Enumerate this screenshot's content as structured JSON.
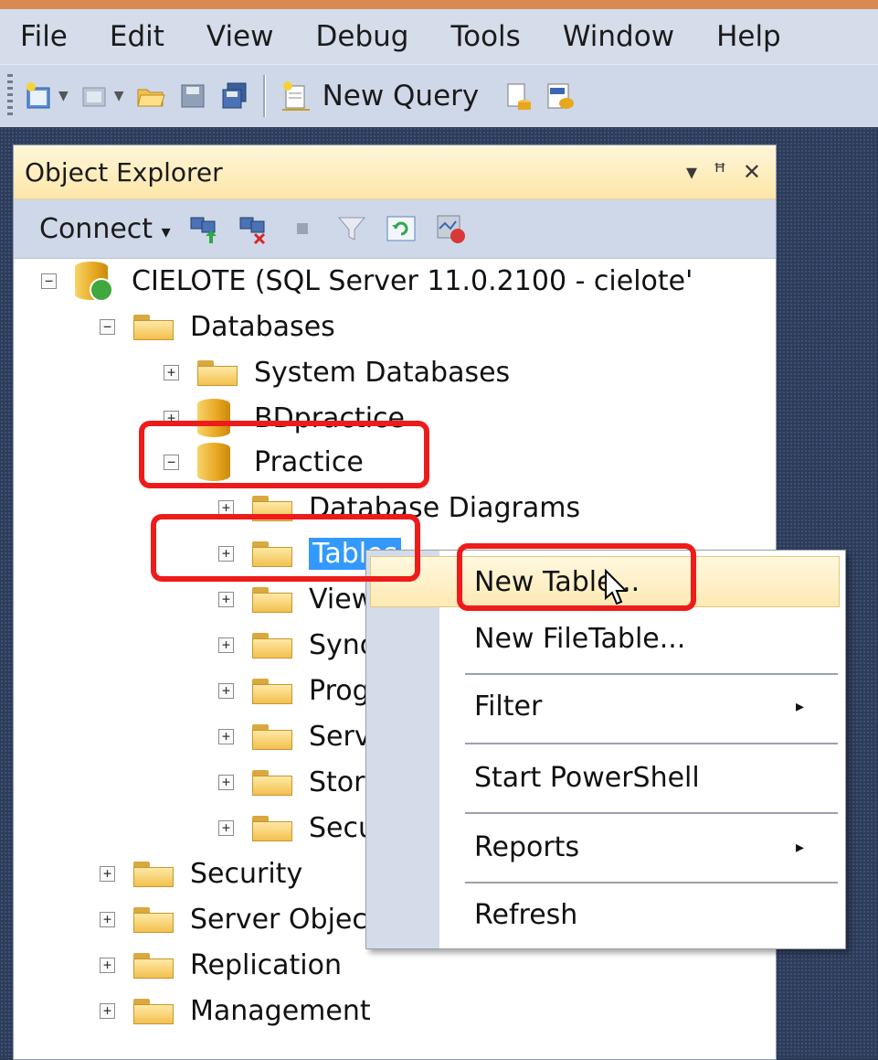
{
  "menu": [
    "File",
    "Edit",
    "View",
    "Debug",
    "Tools",
    "Window",
    "Help"
  ],
  "toolbar": {
    "new_query_label": "New Query"
  },
  "object_explorer": {
    "title": "Object Explorer",
    "title_icons": {
      "dropdown": "▾",
      "pin": "ꟸ",
      "close": "✕"
    },
    "connect_label": "Connect",
    "connect_arrow": "▾"
  },
  "tree": {
    "server": "CIELOTE (SQL Server 11.0.2100 - cielote'",
    "databases": "Databases",
    "system_databases": "System Databases",
    "bdpractice": "BDpractice",
    "practice": "Practice",
    "database_diagrams": "Database Diagrams",
    "tables": "Tables",
    "views": "Views",
    "synonyms": "Synonyms",
    "programmability": "Programmability",
    "service_broker": "Service Broker",
    "storage": "Storage",
    "security_inner": "Security",
    "security": "Security",
    "server_objects": "Server Objects",
    "replication": "Replication",
    "management": "Management"
  },
  "expanders": {
    "expanded": "−",
    "collapsed": "+"
  },
  "context_menu": {
    "items": [
      "New Table...",
      "New FileTable...",
      "Filter",
      "Start PowerShell",
      "Reports",
      "Refresh"
    ],
    "submenu_arrow": "▸"
  },
  "colors": {
    "highlight_red": "#ee1b1b",
    "selection_blue": "#3399ff"
  }
}
